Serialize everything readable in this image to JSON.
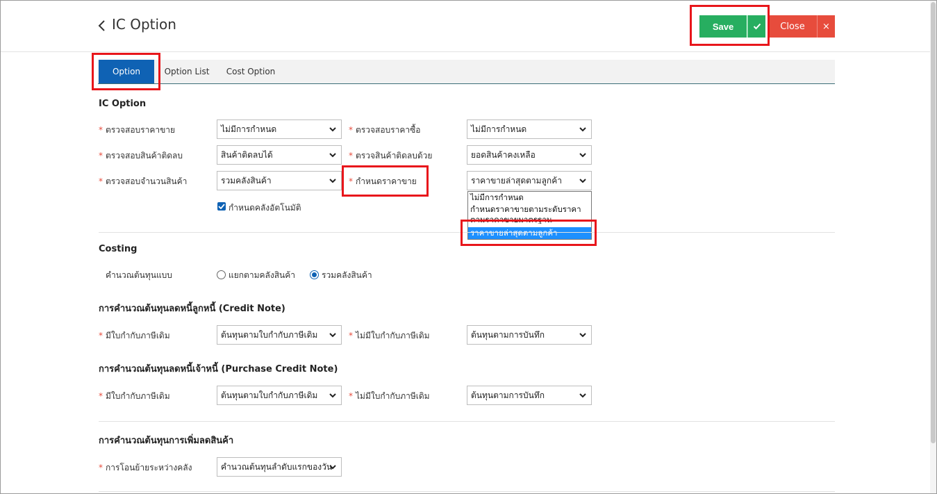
{
  "header": {
    "title": "IC Option",
    "save_label": "Save",
    "close_label": "Close",
    "close_x": "×"
  },
  "tabs": [
    {
      "label": "Option",
      "active": true
    },
    {
      "label": "Option List",
      "active": false
    },
    {
      "label": "Cost Option",
      "active": false
    }
  ],
  "ic_option": {
    "title": "IC Option",
    "check_sell_price_label": "ตรวจสอบราคาขาย",
    "check_sell_price_value": "ไม่มีการกำหนด",
    "check_buy_price_label": "ตรวจสอบราคาซื้อ",
    "check_buy_price_value": "ไม่มีการกำหนด",
    "check_negative_label": "ตรวจสอบสินค้าติดลบ",
    "check_negative_value": "สินค้าติดลบได้",
    "check_negative_by_label": "ตรวจสินค้าติดลบด้วย",
    "check_negative_by_value": "ยอดสินค้าคงเหลือ",
    "check_qty_label": "ตรวจสอบจำนวนสินค้า",
    "check_qty_value": "รวมคลังสินค้า",
    "set_price_label": "กำหนดราคาขาย",
    "set_price_value": "ราคาขายล่าสุดตามลูกค้า",
    "auto_warehouse_label": "กำหนดคลังอัตโนมัติ",
    "price_options": [
      "ไม่มีการกำหนด",
      "กำหนดราคาขายตามระดับราคา",
      "ตามราคาขายมาตรฐาน",
      "ราคาขายล่าสุดตามลูกค้า"
    ]
  },
  "costing": {
    "title": "Costing",
    "calc_label": "คำนวณต้นทุนแบบ",
    "radio_separate": "แยกตามคลังสินค้า",
    "radio_combined": "รวมคลังสินค้า"
  },
  "credit_note": {
    "title": "การคำนวณต้นทุนลดหนี้ลูกหนี้ (Credit Note)",
    "has_invoice_label": "มีใบกำกับภาษีเดิม",
    "has_invoice_value": "ต้นทุนตามใบกำกับภาษีเดิม",
    "no_invoice_label": "ไม่มีใบกำกับภาษีเดิม",
    "no_invoice_value": "ต้นทุนตามการบันทึก"
  },
  "purchase_credit_note": {
    "title": "การคำนวณต้นทุนลดหนี้เจ้าหนี้ (Purchase Credit Note)",
    "has_invoice_label": "มีใบกำกับภาษีเดิม",
    "has_invoice_value": "ต้นทุนตามใบกำกับภาษีเดิม",
    "no_invoice_label": "ไม่มีใบกำกับภาษีเดิม",
    "no_invoice_value": "ต้นทุนตามการบันทึก"
  },
  "stock_adjust": {
    "title": "การคำนวณต้นทุนการเพิ่มลดสินค้า",
    "transfer_label": "การโอนย้ายระหว่างคลัง",
    "transfer_value": "คำนวณต้นทุนลำดับแรกของวัน"
  },
  "colors": {
    "accent": "#0f62b4",
    "save": "#27ae60",
    "close": "#e74c3c",
    "highlight": "#e8161b"
  }
}
